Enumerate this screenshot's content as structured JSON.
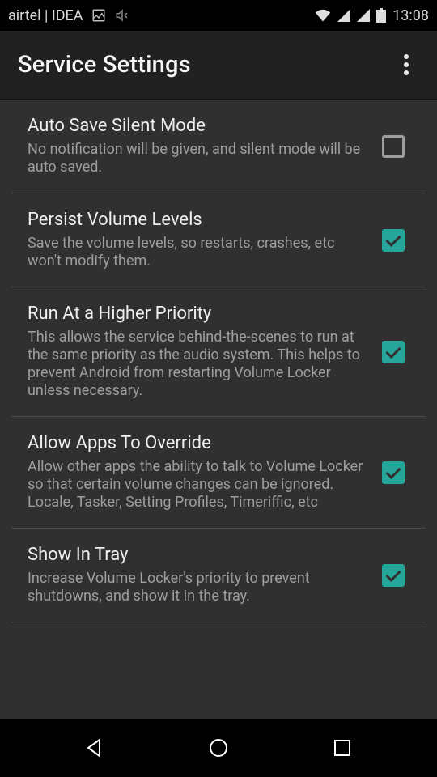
{
  "statusbar": {
    "carrier": "airtel | IDEA",
    "time": "13:08"
  },
  "actionbar": {
    "title": "Service Settings"
  },
  "prefs": [
    {
      "title": "Auto Save Silent Mode",
      "summary": "No notification will be given, and silent mode will be auto saved.",
      "checked": false
    },
    {
      "title": "Persist Volume Levels",
      "summary": "Save the volume levels, so restarts, crashes, etc won't modify them.",
      "checked": true
    },
    {
      "title": "Run At a Higher Priority",
      "summary": "This allows the service behind-the-scenes to run at the same priority as the audio system. This helps to prevent Android from restarting Volume Locker unless necessary.",
      "checked": true
    },
    {
      "title": "Allow Apps To Override",
      "summary": "Allow other apps the ability to talk to Volume Locker so that certain volume changes can be ignored. Locale, Tasker, Setting Profiles, Timeriffic, etc",
      "checked": true
    },
    {
      "title": "Show In Tray",
      "summary": "Increase Volume Locker's priority to prevent shutdowns, and show it in the tray.",
      "checked": true
    }
  ]
}
